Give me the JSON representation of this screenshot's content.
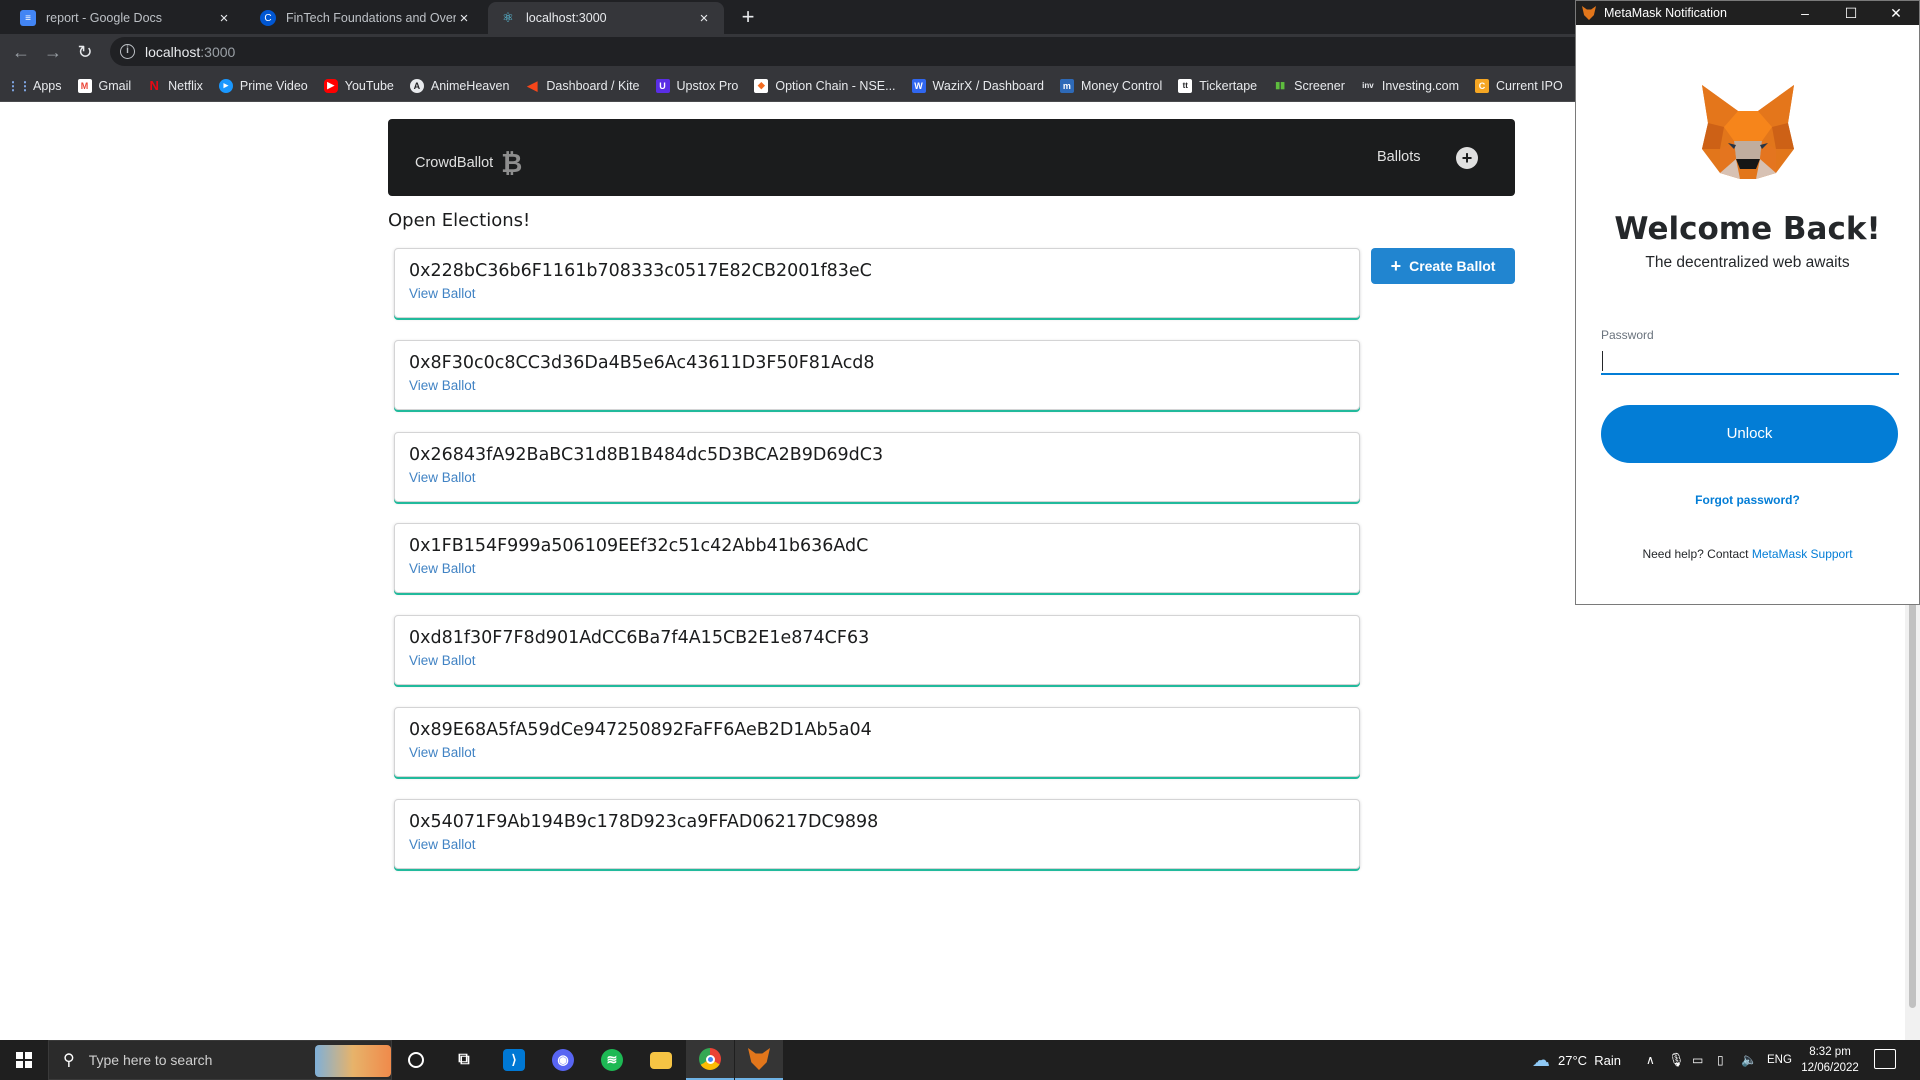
{
  "browser": {
    "tabs": [
      {
        "title": "report - Google Docs",
        "icon": "docs-icon",
        "color": "#4285f4"
      },
      {
        "title": "FinTech Foundations and Overvie",
        "icon": "coursera-icon",
        "color": "#0056d2"
      },
      {
        "title": "localhost:3000",
        "icon": "react-icon",
        "color": "#61dafb"
      }
    ],
    "url_host": "localhost",
    "url_port": ":3000",
    "bookmarks": [
      {
        "label": "Apps",
        "icon": "apps-grid-icon",
        "color": "#e8eaed"
      },
      {
        "label": "Gmail",
        "icon": "gmail-icon",
        "color": "#ea4335"
      },
      {
        "label": "Netflix",
        "icon": "netflix-icon",
        "color": "#e50914"
      },
      {
        "label": "Prime Video",
        "icon": "prime-video-icon",
        "color": "#1a98ff"
      },
      {
        "label": "YouTube",
        "icon": "youtube-icon",
        "color": "#ff0000"
      },
      {
        "label": "AnimeHeaven",
        "icon": "animeheaven-icon",
        "color": "#e8eaed"
      },
      {
        "label": "Dashboard / Kite",
        "icon": "kite-icon",
        "color": "#f6461a"
      },
      {
        "label": "Upstox Pro",
        "icon": "upstox-icon",
        "color": "#5a2ee5"
      },
      {
        "label": "Option Chain - NSE...",
        "icon": "nse-icon",
        "color": "#f26b21"
      },
      {
        "label": "WazirX / Dashboard",
        "icon": "wazirx-icon",
        "color": "#3067f0"
      },
      {
        "label": "Money Control",
        "icon": "moneycontrol-icon",
        "color": "#2e6ab8"
      },
      {
        "label": "Tickertape",
        "icon": "tickertape-icon",
        "color": "#e8eaed"
      },
      {
        "label": "Screener",
        "icon": "screener-icon",
        "color": "#5ebd3e"
      },
      {
        "label": "Investing.com",
        "icon": "investing-icon",
        "color": "#e8eaed"
      },
      {
        "label": "Current IPO",
        "icon": "ipo-icon",
        "color": "#f5a623"
      }
    ]
  },
  "app": {
    "brand": "CrowdBallot",
    "nav_ballots": "Ballots",
    "heading": "Open Elections!",
    "create_label": "Create Ballot",
    "view_label": "View Ballot",
    "ballots": [
      "0x228bC36b6F1161b708333c0517E82CB2001f83eC",
      "0x8F30c0c8CC3d36Da4B5e6Ac43611D3F50F81Acd8",
      "0x26843fA92BaBC31d8B1B484dc5D3BCA2B9D69dC3",
      "0x1FB154F999a506109EEf32c51c42Abb41b636AdC",
      "0xd81f30F7F8d901AdCC6Ba7f4A15CB2E1e874CF63",
      "0x89E68A5fA59dCe947250892FaFF6AeB2D1Ab5a04",
      "0x54071F9Ab194B9c178D923ca9FFAD06217DC9898"
    ],
    "accent": "#21ba9c",
    "button_color": "#2185d0"
  },
  "metamask": {
    "window_title": "MetaMask Notification",
    "welcome": "Welcome Back!",
    "subtitle": "The decentralized web awaits",
    "password_label": "Password",
    "password_value": "",
    "unlock": "Unlock",
    "forgot": "Forgot password?",
    "help_prefix": "Need help? Contact ",
    "help_link": "MetaMask Support",
    "accent": "#037dd6"
  },
  "taskbar": {
    "search_placeholder": "Type here to search",
    "weather": "27°C  Rain",
    "language": "ENG",
    "time": "8:32 pm",
    "date": "12/06/2022"
  }
}
